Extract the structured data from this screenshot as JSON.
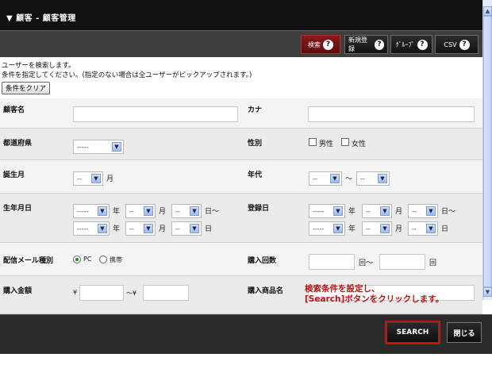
{
  "window": {
    "title": "▼ 顧客 - 顧客管理"
  },
  "toolbar": {
    "buttons": [
      {
        "label": "検索",
        "icon": "help-icon"
      },
      {
        "label": "新規登録",
        "icon": "help-icon"
      },
      {
        "label": "ｸﾞﾙｰﾌﾟ",
        "icon": "help-icon"
      },
      {
        "label": "CSV",
        "icon": "help-icon"
      }
    ],
    "help_glyph": "?"
  },
  "info": {
    "line1": "ユーザーを検索します。",
    "line2": "条件を指定してください。(指定のない場合は全ユーザーがピックアップされます。)",
    "clear_button": "条件をクリア"
  },
  "form": {
    "customer_name": {
      "label": "顧客名",
      "value": ""
    },
    "kana": {
      "label": "カナ",
      "value": ""
    },
    "prefecture": {
      "label": "都道府県",
      "selected": "-----"
    },
    "gender": {
      "label": "性別",
      "options": [
        "男性",
        "女性"
      ]
    },
    "birth_month": {
      "label": "誕生月",
      "selected": "--",
      "unit": "月"
    },
    "age": {
      "label": "年代",
      "from": "--",
      "to": "--",
      "tilde": "～"
    },
    "birthdate": {
      "label": "生年月日",
      "year_from": "-----",
      "month_from": "--",
      "day_from": "--",
      "year_to": "-----",
      "month_to": "--",
      "day_to": "--",
      "unit_year": "年",
      "unit_month": "月",
      "unit_day_from": "日～",
      "unit_day_to": "日"
    },
    "registered": {
      "label": "登録日",
      "year_from": "-----",
      "month_from": "--",
      "day_from": "--",
      "year_to": "-----",
      "month_to": "--",
      "day_to": "--",
      "unit_year": "年",
      "unit_month": "月",
      "unit_day_from": "日～",
      "unit_day_to": "日"
    },
    "mail_type": {
      "label": "配信メール種別",
      "options": [
        "PC",
        "携帯"
      ],
      "selected": "PC"
    },
    "purchase_count": {
      "label": "購入回数",
      "unit_from": "回～",
      "unit_to": "回"
    },
    "purchase_amount": {
      "label": "購入金額",
      "currency_from": "¥",
      "currency_to": "～¥"
    },
    "purchased_product": {
      "label": "購入商品名"
    }
  },
  "annotation": {
    "line1": "検索条件を設定し、",
    "line2": "[Search]ボタンをクリックします。",
    "color": "#c21010"
  },
  "footer": {
    "search_label": "SEARCH",
    "close_label": "閉じる"
  },
  "colors": {
    "title_bg": "#101010",
    "toolbar_bg": "#3e3e3e",
    "active_button": "#8a1a1a",
    "search_highlight": "#cc1010"
  }
}
